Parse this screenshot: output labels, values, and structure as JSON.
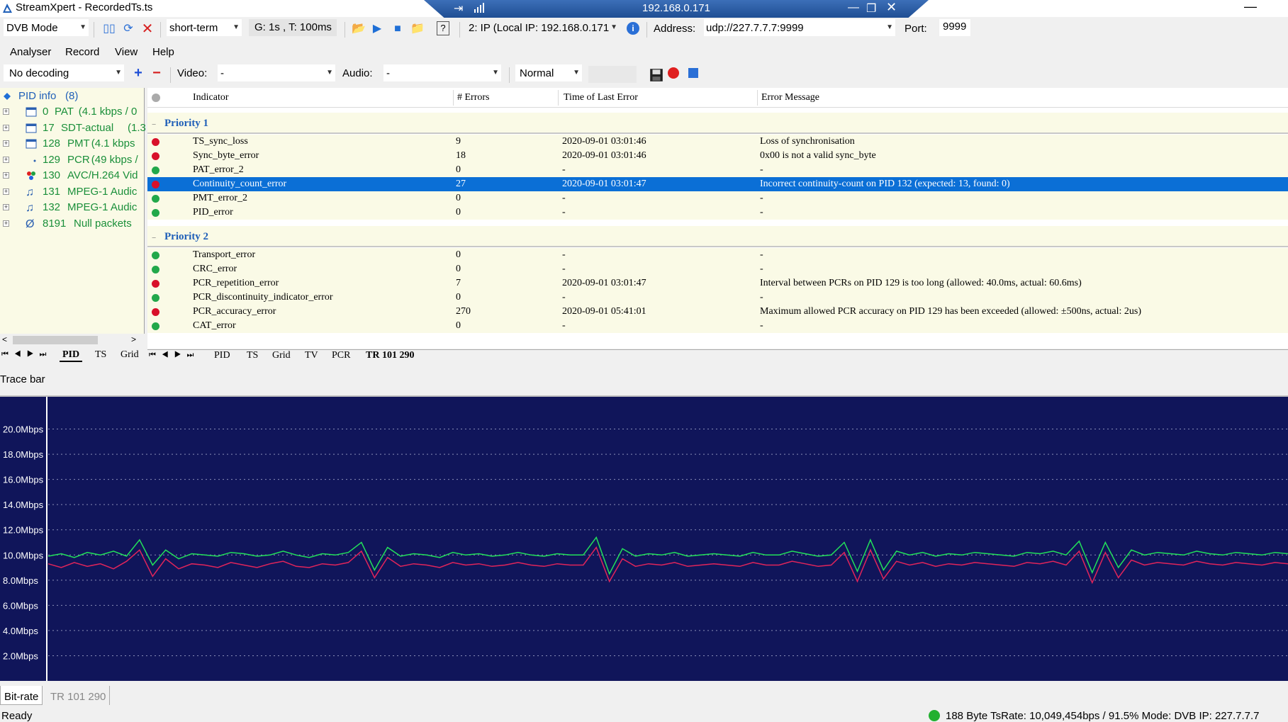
{
  "window": {
    "title": "StreamXpert - RecordedTs.ts",
    "remote_host": "192.168.0.171"
  },
  "toolbar1": {
    "mode": "DVB Mode",
    "term": "short-term",
    "interval": "G: 1s , T: 100ms",
    "source": "2: IP (Local IP: 192.168.0.171",
    "address_label": "Address:",
    "address_value": "udp://227.7.7.7:9999",
    "port_label": "Port:",
    "port_value": "9999"
  },
  "menu": {
    "items": [
      "Analyser",
      "Record",
      "View",
      "Help"
    ]
  },
  "toolbar2": {
    "decoding": "No decoding",
    "video_label": "Video:",
    "video_value": "-",
    "audio_label": "Audio:",
    "audio_value": "-",
    "speed": "Normal"
  },
  "pid_tree": {
    "root": "PID info",
    "count": "(8)",
    "items": [
      {
        "pid": "0",
        "name": "PAT",
        "detail": "(4.1 kbps / 0",
        "icon": "table-icon"
      },
      {
        "pid": "17",
        "name": "SDT-actual",
        "detail": "(1.3",
        "icon": "table-icon"
      },
      {
        "pid": "128",
        "name": "PMT",
        "detail": "(4.1 kbps",
        "icon": "table-icon"
      },
      {
        "pid": "129",
        "name": "PCR",
        "detail": "(49 kbps /",
        "icon": "pcr-dot-icon"
      },
      {
        "pid": "130",
        "name": "AVC/H.264 Vid",
        "detail": "",
        "icon": "video-icon"
      },
      {
        "pid": "131",
        "name": "MPEG-1 Audic",
        "detail": "",
        "icon": "audio-note-icon"
      },
      {
        "pid": "132",
        "name": "MPEG-1 Audic",
        "detail": "",
        "icon": "audio-note-icon"
      },
      {
        "pid": "8191",
        "name": "Null packets",
        "detail": "",
        "icon": "null-icon"
      }
    ]
  },
  "left_tabs": [
    "PID",
    "TS",
    "Grid"
  ],
  "right_tabs": [
    "PID",
    "TS",
    "Grid",
    "TV",
    "PCR",
    "TR 101 290"
  ],
  "grid": {
    "columns": [
      "Indicator",
      "# Errors",
      "Time of Last Error",
      "Error Message"
    ],
    "priority1_label": "Priority 1",
    "priority2_label": "Priority 2",
    "priority1": [
      {
        "status": "error",
        "indicator": "TS_sync_loss",
        "errors": "9",
        "time": "2020-09-01 03:01:46",
        "message": "Loss of synchronisation"
      },
      {
        "status": "error",
        "indicator": "Sync_byte_error",
        "errors": "18",
        "time": "2020-09-01 03:01:46",
        "message": "0x00 is not a valid sync_byte"
      },
      {
        "status": "ok",
        "indicator": "PAT_error_2",
        "errors": "0",
        "time": "-",
        "message": "-"
      },
      {
        "status": "error",
        "indicator": "Continuity_count_error",
        "errors": "27",
        "time": "2020-09-01 03:01:47",
        "message": "Incorrect continuity-count on PID 132 (expected: 13, found: 0)",
        "selected": true
      },
      {
        "status": "ok",
        "indicator": "PMT_error_2",
        "errors": "0",
        "time": "-",
        "message": "-"
      },
      {
        "status": "ok",
        "indicator": "PID_error",
        "errors": "0",
        "time": "-",
        "message": "-"
      }
    ],
    "priority2": [
      {
        "status": "ok",
        "indicator": "Transport_error",
        "errors": "0",
        "time": "-",
        "message": "-"
      },
      {
        "status": "ok",
        "indicator": "CRC_error",
        "errors": "0",
        "time": "-",
        "message": "-"
      },
      {
        "status": "error",
        "indicator": "PCR_repetition_error",
        "errors": "7",
        "time": "2020-09-01 03:01:47",
        "message": "Interval between PCRs on PID 129 is too long (allowed: 40.0ms, actual: 60.6ms)"
      },
      {
        "status": "ok",
        "indicator": "PCR_discontinuity_indicator_error",
        "errors": "0",
        "time": "-",
        "message": "-"
      },
      {
        "status": "error",
        "indicator": "PCR_accuracy_error",
        "errors": "270",
        "time": "2020-09-01 05:41:01",
        "message": "Maximum allowed PCR accuracy on PID 129 has been exceeded (allowed: ±500ns, actual: 2us)"
      },
      {
        "status": "ok",
        "indicator": "CAT_error",
        "errors": "0",
        "time": "-",
        "message": "-"
      }
    ]
  },
  "trace": {
    "label": "Trace bar",
    "tabs": [
      "Bit-rate",
      "TR 101 290"
    ]
  },
  "chart_data": {
    "type": "line",
    "ylabels": [
      "20.0Mbps",
      "18.0Mbps",
      "16.0Mbps",
      "14.0Mbps",
      "12.0Mbps",
      "10.0Mbps",
      "8.0Mbps",
      "6.0Mbps",
      "4.0Mbps",
      "2.0Mbps"
    ],
    "ylim": [
      0,
      22
    ],
    "grid": true,
    "series": [
      {
        "color": "#22e05a",
        "values": [
          9.9,
          10.1,
          9.8,
          10.2,
          10.0,
          10.3,
          9.9,
          11.2,
          9.2,
          10.4,
          9.7,
          10.1,
          10.0,
          9.9,
          10.2,
          10.1,
          9.9,
          10.0,
          10.3,
          10.0,
          9.8,
          10.1,
          10.0,
          10.2,
          11.0,
          8.8,
          10.6,
          9.9,
          10.1,
          10.0,
          9.8,
          10.2,
          10.0,
          10.1,
          9.9,
          10.0,
          10.2,
          10.0,
          9.9,
          10.1,
          10.0,
          10.0,
          11.4,
          8.5,
          10.5,
          9.9,
          10.1,
          10.0,
          10.2,
          9.9,
          10.0,
          10.1,
          10.0,
          9.9,
          10.2,
          10.0,
          10.0,
          10.3,
          10.1,
          9.9,
          10.0,
          11.0,
          8.7,
          11.2,
          8.8,
          10.3,
          10.0,
          10.2,
          9.9,
          10.1,
          10.0,
          10.2,
          10.1,
          10.0,
          9.9,
          10.2,
          10.1,
          10.3,
          10.0,
          11.1,
          8.6,
          11.0,
          9.0,
          10.4,
          10.0,
          10.2,
          10.1,
          10.0,
          10.3,
          10.1,
          10.0,
          10.2,
          10.1,
          10.0,
          10.2,
          10.1
        ]
      },
      {
        "color": "#e0245a",
        "values": [
          9.3,
          9.0,
          9.4,
          9.1,
          9.3,
          8.9,
          9.5,
          10.4,
          8.3,
          9.7,
          8.9,
          9.3,
          9.2,
          9.0,
          9.4,
          9.2,
          9.0,
          9.3,
          9.5,
          9.1,
          9.0,
          9.3,
          9.2,
          9.4,
          10.3,
          8.2,
          9.8,
          9.1,
          9.3,
          9.2,
          9.0,
          9.4,
          9.2,
          9.3,
          9.1,
          9.2,
          9.4,
          9.2,
          9.1,
          9.3,
          9.2,
          9.2,
          10.6,
          7.9,
          9.7,
          9.1,
          9.3,
          9.2,
          9.4,
          9.1,
          9.2,
          9.3,
          9.2,
          9.1,
          9.4,
          9.2,
          9.2,
          9.5,
          9.3,
          9.1,
          9.2,
          10.2,
          7.9,
          10.4,
          8.1,
          9.5,
          9.2,
          9.4,
          9.1,
          9.3,
          9.2,
          9.4,
          9.3,
          9.2,
          9.1,
          9.4,
          9.3,
          9.5,
          9.2,
          10.3,
          7.8,
          10.2,
          8.2,
          9.6,
          9.2,
          9.4,
          9.3,
          9.2,
          9.5,
          9.3,
          9.2,
          9.4,
          9.3,
          9.2,
          9.4,
          9.3
        ]
      }
    ]
  },
  "status": {
    "ready": "Ready",
    "right": "188 Byte   TsRate: 10,049,454bps / 91.5%   Mode: DVB   IP: 227.7.7.7"
  }
}
